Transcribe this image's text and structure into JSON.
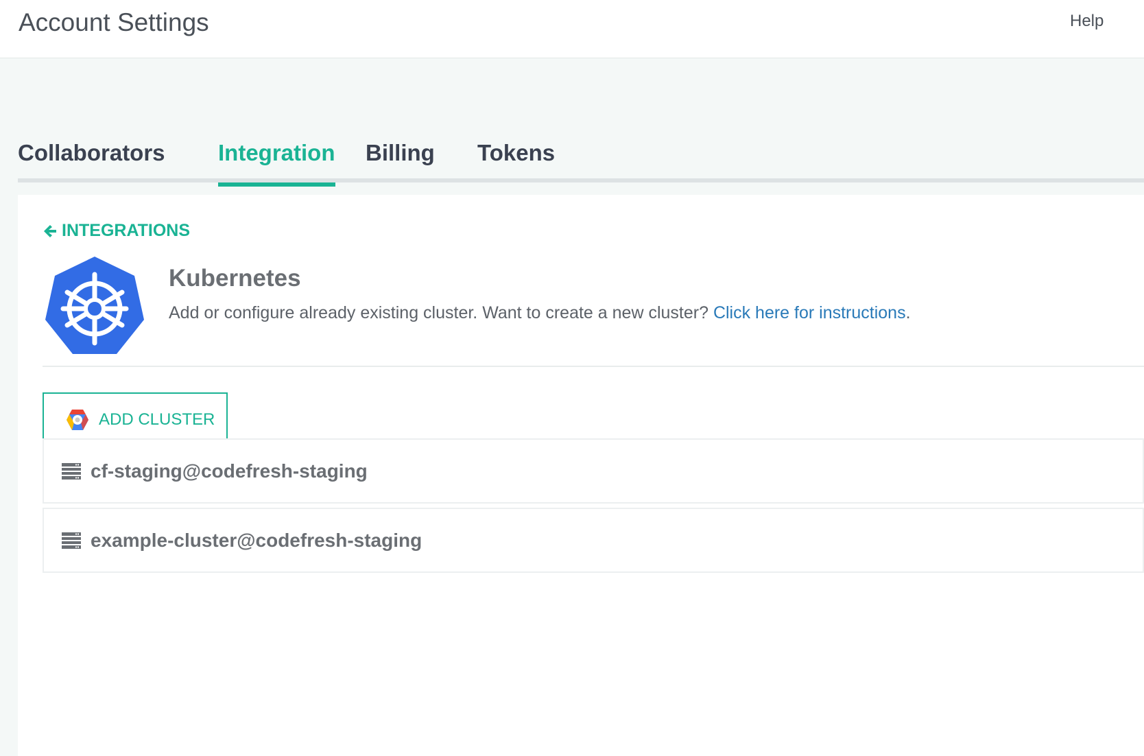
{
  "header": {
    "title": "Account Settings",
    "help_label": "Help"
  },
  "tabs": [
    {
      "label": "Collaborators",
      "active": false
    },
    {
      "label": "Integration",
      "active": true
    },
    {
      "label": "Billing",
      "active": false
    },
    {
      "label": "Tokens",
      "active": false
    }
  ],
  "integration": {
    "back_label": "INTEGRATIONS",
    "back_icon": "arrow-left-icon",
    "logo_icon": "kubernetes-logo",
    "name": "Kubernetes",
    "description": "Add or configure already existing cluster. Want to create a new cluster?",
    "link_text": "Click here for instructions",
    "link_suffix": ".",
    "add_button_label": "ADD CLUSTER",
    "add_button_icon": "google-cloud-icon",
    "clusters": [
      {
        "name": "cf-staging@codefresh-staging",
        "icon": "server-icon"
      },
      {
        "name": "example-cluster@codefresh-staging",
        "icon": "server-icon"
      }
    ]
  },
  "colors": {
    "accent": "#1ab394",
    "link": "#2a7ab8",
    "kubernetes_blue": "#326ce5"
  }
}
